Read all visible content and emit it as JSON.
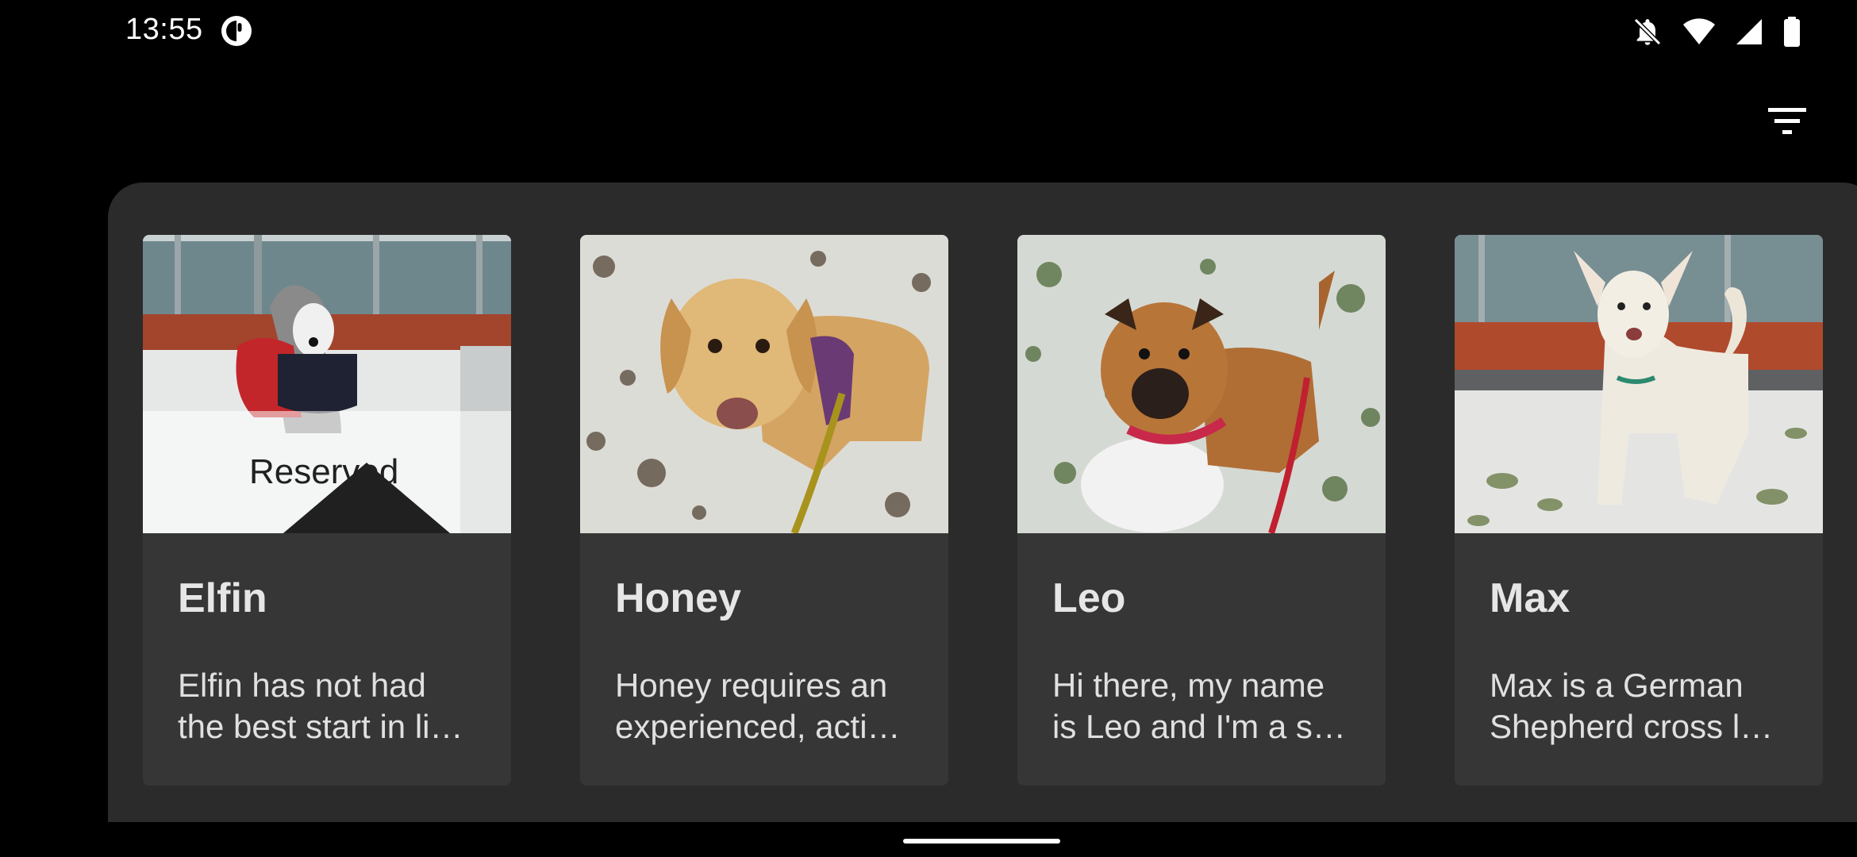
{
  "status_bar": {
    "time": "13:55",
    "icons": [
      "app-notification-icon",
      "bell-off-icon",
      "wifi-icon",
      "cell-signal-icon",
      "battery-icon"
    ]
  },
  "toolbar": {
    "filter_icon": "filter-icon"
  },
  "dogs": [
    {
      "name": "Elfin",
      "desc_line1": "Elfin has not had",
      "desc_line2": "the best start in li…",
      "badge": "Reserved",
      "badge_icon": "home-icon"
    },
    {
      "name": "Honey",
      "desc_line1": "Honey requires an",
      "desc_line2": "experienced, acti…"
    },
    {
      "name": "Leo",
      "desc_line1": "Hi there, my name",
      "desc_line2": "is Leo and I'm a s…"
    },
    {
      "name": "Max",
      "desc_line1": "Max is a German",
      "desc_line2": "Shepherd cross l…"
    }
  ],
  "colors": {
    "background": "#000000",
    "panel": "#2b2b2b",
    "card": "#363636",
    "text": "#e6e6e6"
  }
}
